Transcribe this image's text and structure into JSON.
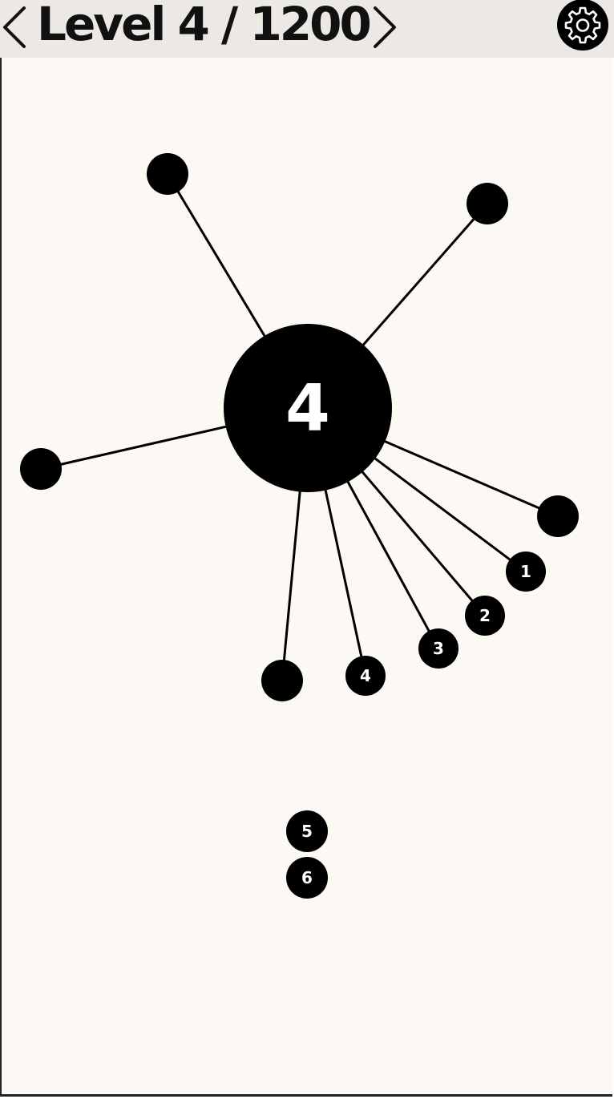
{
  "header": {
    "prev_icon": "chevron-left-icon",
    "level_title": "Level 4 / 1200",
    "next_icon": "chevron-right-icon",
    "settings_icon": "gear-icon"
  },
  "game": {
    "core_number": "4",
    "colors": {
      "background": "#fcf8f3",
      "header": "#ece9e4",
      "ink": "#000000",
      "label": "#ffffff"
    },
    "stuck_ball_labels": [
      "1",
      "2",
      "3",
      "4"
    ],
    "queue_labels": [
      "5",
      "6"
    ]
  }
}
